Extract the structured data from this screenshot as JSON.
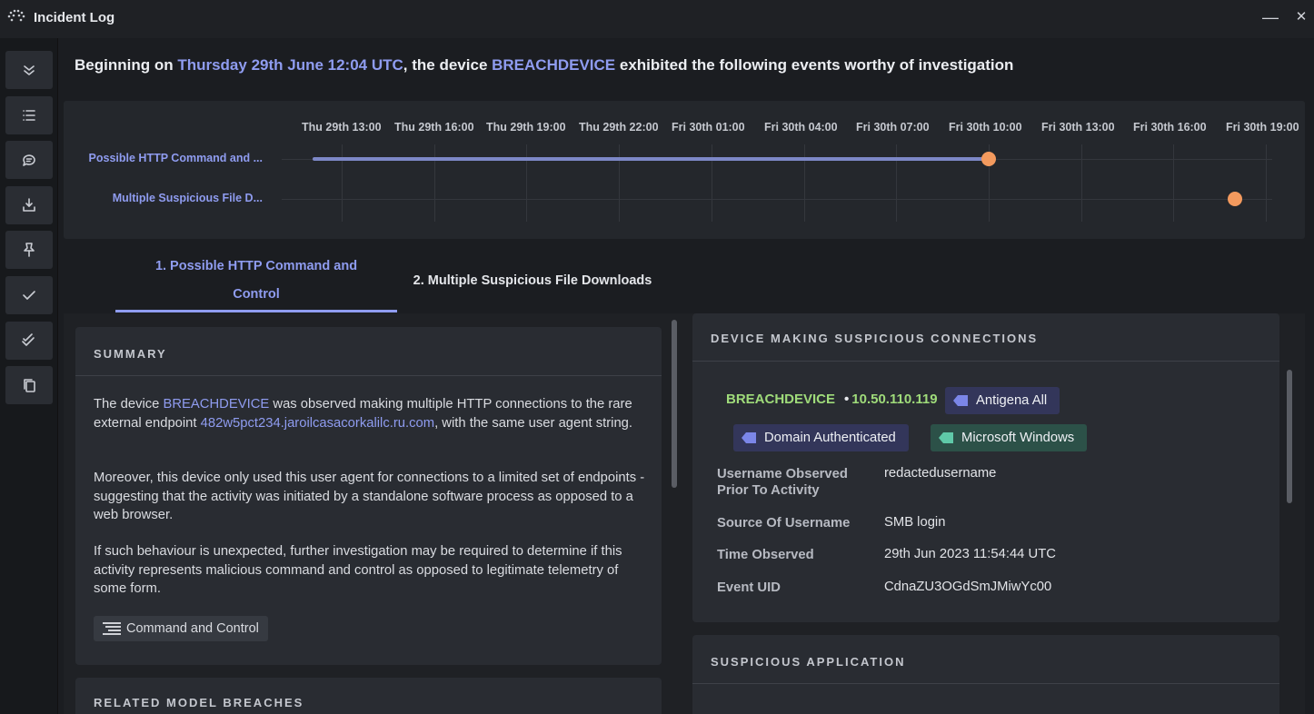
{
  "window": {
    "title": "Incident Log",
    "minimize_glyph": "—",
    "close_glyph": "✕"
  },
  "rail": {
    "items": [
      {
        "icon": "collapse-chevrons-icon"
      },
      {
        "icon": "list-icon"
      },
      {
        "icon": "comment-icon"
      },
      {
        "icon": "download-icon"
      },
      {
        "icon": "pin-icon"
      },
      {
        "icon": "check-icon"
      },
      {
        "icon": "double-check-icon"
      },
      {
        "icon": "copy-icon"
      }
    ]
  },
  "header": {
    "prefix": "Beginning on ",
    "date": "Thursday 29th June 12:04 UTC",
    "middle": ", the device ",
    "device": "BREACHDEVICE",
    "suffix": " exhibited the following events worthy of investigation"
  },
  "timeline": {
    "ticks": [
      "Thu 29th 13:00",
      "Thu 29th 16:00",
      "Thu 29th 19:00",
      "Thu 29th 22:00",
      "Fri 30th 01:00",
      "Fri 30th 04:00",
      "Fri 30th 07:00",
      "Fri 30th 10:00",
      "Fri 30th 13:00",
      "Fri 30th 16:00",
      "Fri 30th 19:00"
    ],
    "rows": [
      {
        "label": "Possible HTTP Command and ...",
        "start": "Thu 29th 12:04",
        "end": "Fri 30th 10:00"
      },
      {
        "label": "Multiple Suspicious File D...",
        "start": "Fri 30th 18:00",
        "end": "Fri 30th 18:00"
      }
    ]
  },
  "tabs": [
    {
      "label": "1. Possible HTTP Command and Control",
      "active": true
    },
    {
      "label": "2. Multiple Suspicious File Downloads",
      "active": false
    }
  ],
  "summary": {
    "title": "SUMMARY",
    "p1_a": "The device ",
    "p1_device": "BREACHDEVICE",
    "p1_b": " was observed making multiple HTTP connections to the rare external endpoint ",
    "p1_endpoint": "482w5pct234.jaroilcasacorkalilc.ru.com",
    "p1_c": ", with the same user agent string.",
    "p2": "Moreover, this device only used this user agent for connections to a limited set of endpoints - suggesting that the activity was initiated by a standalone software process as opposed to a web browser.",
    "p3": "If such behaviour is unexpected, further investigation may be required to determine if this activity represents malicious command and control as opposed to legitimate telemetry of some form.",
    "tag": "Command and Control",
    "next_title": "RELATED MODEL BREACHES"
  },
  "device_card": {
    "title": "DEVICE MAKING SUSPICIOUS CONNECTIONS",
    "name": "BREACHDEVICE",
    "ip": "10.50.110.119",
    "chips": [
      {
        "label": "Antigena All",
        "color": "#7b86e8"
      },
      {
        "label": "Domain Authenticated",
        "color": "#7b86e8"
      },
      {
        "label": "Microsoft Windows",
        "color": "#5fc9a8"
      }
    ],
    "fields": [
      {
        "key": "Username Observed Prior To Activity",
        "value": "redactedusername"
      },
      {
        "key": "Source Of Username",
        "value": "SMB login"
      },
      {
        "key": "Time Observed",
        "value": "29th Jun 2023 11:54:44 UTC"
      },
      {
        "key": "Event UID",
        "value": "CdnaZU3OGdSmJMiwYc00"
      }
    ]
  },
  "suspicious_app": {
    "title": "SUSPICIOUS APPLICATION"
  },
  "colors": {
    "accent": "#8f9cf0",
    "device_green": "#9fdb7a",
    "timeline_dot": "#f39a5e"
  }
}
